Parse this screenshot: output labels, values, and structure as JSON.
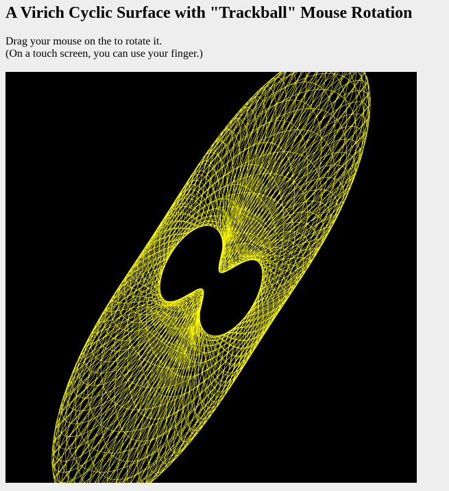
{
  "page": {
    "title": "A Virich Cyclic Surface with \"Trackball\" Mouse Rotation",
    "instructions": [
      "Drag your mouse on the to rotate it.",
      "(On a touch screen, you can use your finger.)"
    ]
  },
  "viewer": {
    "background_color": "#000000",
    "wire_color": "#ffff00",
    "page_background": "#eeeeee"
  }
}
